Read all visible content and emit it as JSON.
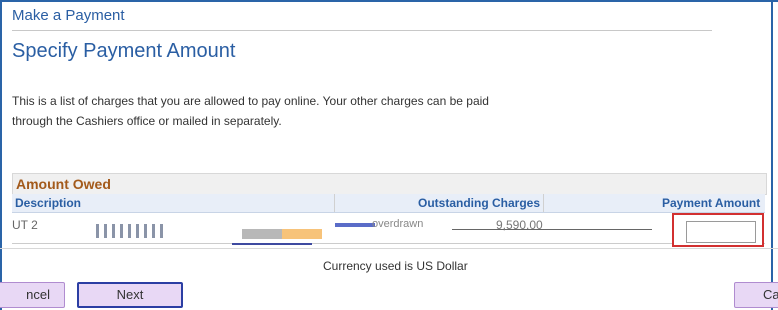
{
  "nav": {
    "title": "Make a Payment"
  },
  "page": {
    "title": "Specify Payment Amount"
  },
  "intro": {
    "line1": "This is a list of charges that you are allowed to pay online. Your other charges can be paid",
    "line2": "through the Cashiers office or mailed in separately."
  },
  "grid": {
    "title": "Amount Owed",
    "columns": {
      "description": "Description",
      "outstanding": "Outstanding Charges",
      "payment": "Payment Amount"
    },
    "rows": [
      {
        "description": "UT 2",
        "charge_label": "overdrawn",
        "outstanding": "9,590.00",
        "payment_value": "",
        "payment_placeholder": ""
      }
    ]
  },
  "footer": {
    "currency_note": "Currency used is US Dollar"
  },
  "buttons": {
    "cancel_left": "ncel",
    "next": "Next",
    "cancel_right": "Can"
  },
  "colors": {
    "link_blue": "#2a5ea3",
    "grid_title": "#a35a1b",
    "button_bg": "#e8d8f5",
    "focus_blue": "#2b3ea3",
    "error_red": "#d23030"
  }
}
